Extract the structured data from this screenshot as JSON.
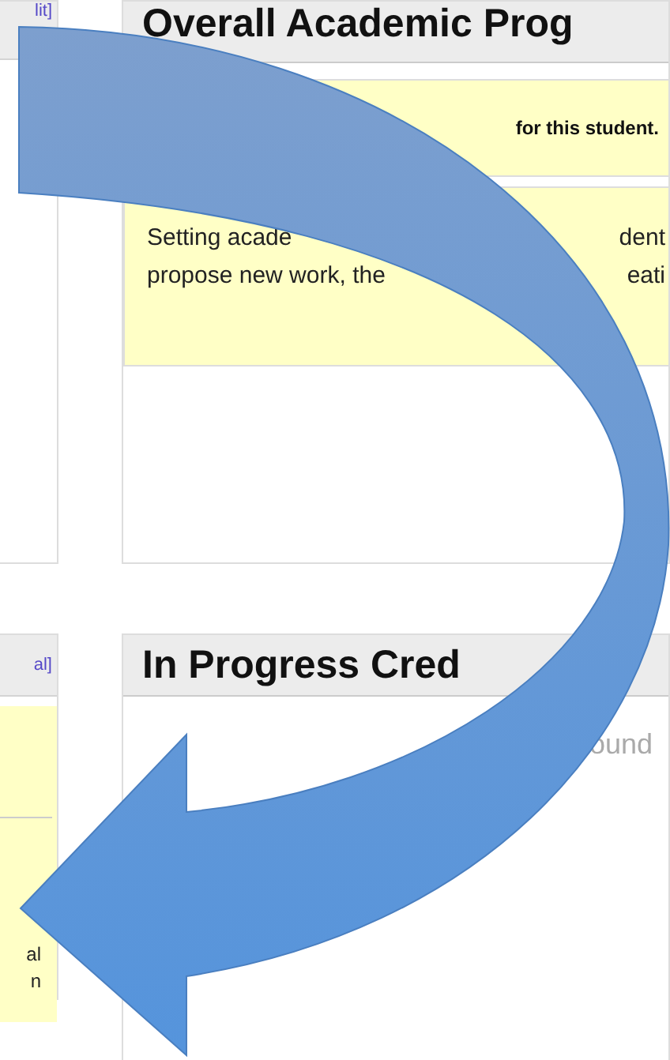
{
  "left_column": {
    "top_panel": {
      "link": "lit]"
    },
    "bottom_panel": {
      "link": "al]",
      "lines": [
        "al",
        "n"
      ]
    }
  },
  "overall_progress": {
    "title": "Overall Academic Prog",
    "notice": "for this student.",
    "description_lines": [
      [
        "Setting acade",
        "dent"
      ],
      [
        "propose new work, the",
        "eati"
      ]
    ]
  },
  "in_progress": {
    "title": "In Progress Cred",
    "message": "ound"
  }
}
